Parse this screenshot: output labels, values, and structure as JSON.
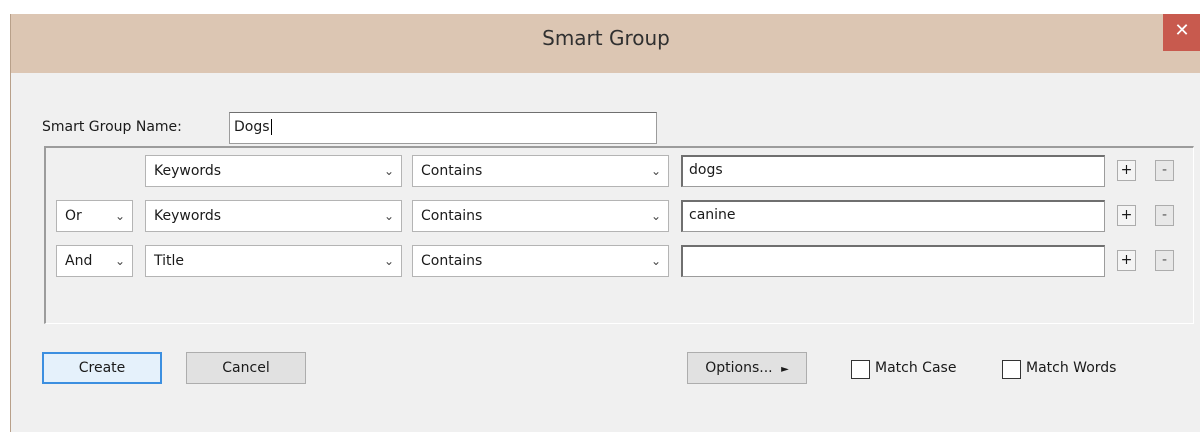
{
  "window": {
    "title": "Smart Group",
    "close_glyph": "✕"
  },
  "name_field": {
    "label": "Smart Group Name:",
    "value": "Dogs"
  },
  "rows": [
    {
      "connector": "",
      "field": "Keywords",
      "operator": "Contains",
      "value": "dogs"
    },
    {
      "connector": "Or",
      "field": "Keywords",
      "operator": "Contains",
      "value": "canine"
    },
    {
      "connector": "And",
      "field": "Title",
      "operator": "Contains",
      "value": ""
    }
  ],
  "row_buttons": {
    "add": "+",
    "remove": "-"
  },
  "dropdown_icon": "chevron-down",
  "buttons": {
    "create": "Create",
    "cancel": "Cancel",
    "options": "Options...",
    "options_arrow": "►"
  },
  "checkboxes": {
    "match_case": {
      "label": "Match Case",
      "checked": false
    },
    "match_words": {
      "label": "Match Words",
      "checked": false
    }
  },
  "colors": {
    "titlebar": "#dcc6b3",
    "close": "#c85a4e",
    "default_button_border": "#3c8fe0"
  }
}
